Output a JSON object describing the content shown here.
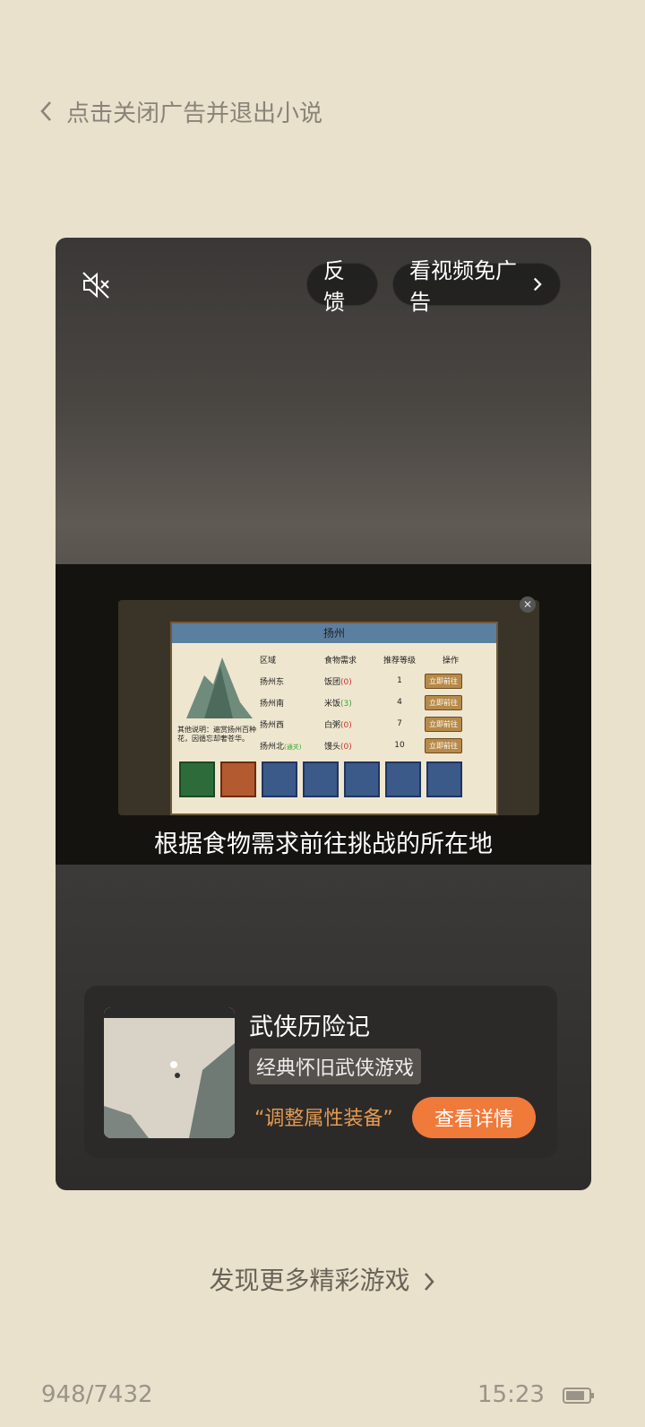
{
  "header": {
    "back_label": "点击关闭广告并退出小说"
  },
  "ad": {
    "feedback_label": "反馈",
    "skip_label": "看视频免广告",
    "subtitle": "根据食物需求前往挑战的所在地",
    "game_panel": {
      "title": "扬州",
      "columns": [
        "区域",
        "食物需求",
        "推荐等级",
        "操作"
      ],
      "rows": [
        {
          "area": "扬州东",
          "food": "饭团",
          "food_count": "(0)",
          "level": "1",
          "action": "立即前往"
        },
        {
          "area": "扬州南",
          "food": "米饭",
          "food_count": "(3)",
          "level": "4",
          "action": "立即前往"
        },
        {
          "area": "扬州西",
          "food": "白粥",
          "food_count": "(0)",
          "level": "7",
          "action": "立即前往"
        },
        {
          "area": "扬州北",
          "area_note": "(通关)",
          "food": "馒头",
          "food_count": "(0)",
          "level": "10",
          "action": "立即前往"
        }
      ],
      "note": "其他说明：遍赏扬州百种花，因循忘却奢苍华。"
    },
    "app": {
      "name": "武侠历险记",
      "tag": "经典怀旧武侠游戏",
      "slogan": "“调整属性装备”",
      "cta_label": "查看详情"
    }
  },
  "more_games_label": "发现更多精彩游戏",
  "footer": {
    "page_progress": "948/7432",
    "time": "15:23"
  },
  "colors": {
    "background": "#e9e1cc",
    "cta": "#f07a3a",
    "slogan": "#e39a53"
  }
}
